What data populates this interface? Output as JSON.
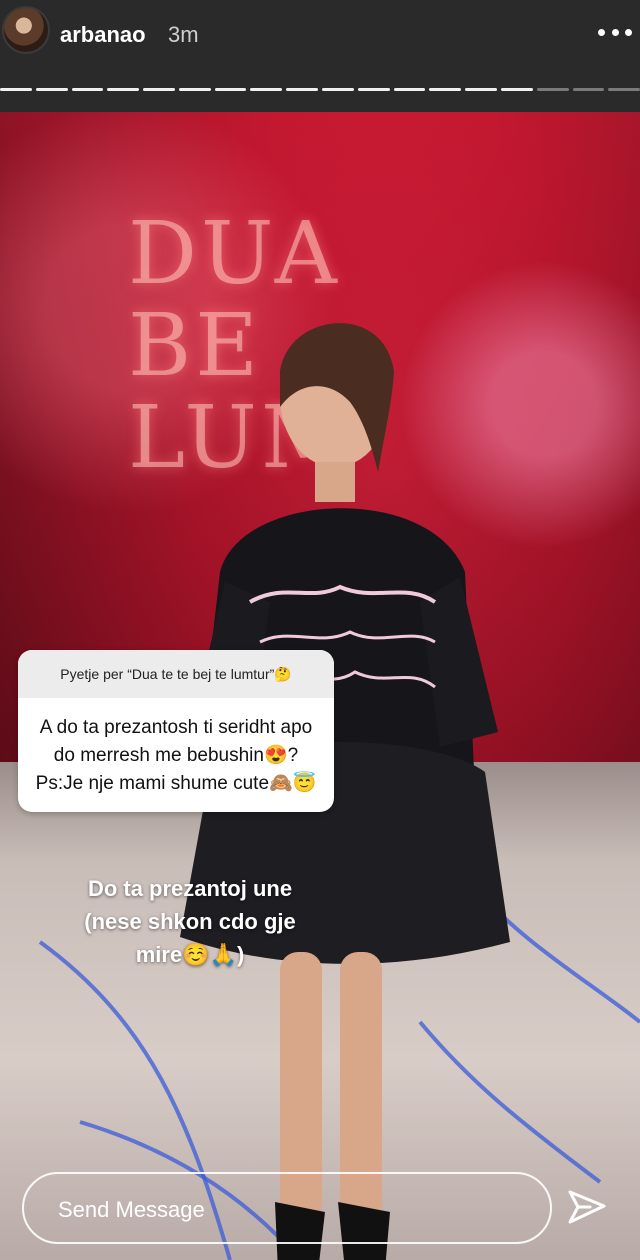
{
  "story": {
    "username": "arbanao",
    "time_ago": "3m",
    "progress_segments": 18,
    "viewed_segments": 15
  },
  "background": {
    "title_lines": [
      "DUA",
      "BE",
      "LUM"
    ]
  },
  "question_sticker": {
    "header": "Pyetje per “Dua te te bej te lumtur”🤔",
    "question_line_1": "A do ta prezantosh ti seridht apo",
    "question_line_2": "do merresh me bebushin😍?",
    "question_line_3": "Ps:Je nje mami shume cute🙈😇"
  },
  "answer": {
    "line_1": "Do ta prezantoj une",
    "line_2": "(nese shkon cdo gje",
    "line_3": "mire☺️🙏)"
  },
  "reply": {
    "placeholder": "Send Message"
  },
  "icons": {
    "more": "more-horizontal-icon",
    "send": "paper-plane-icon"
  }
}
